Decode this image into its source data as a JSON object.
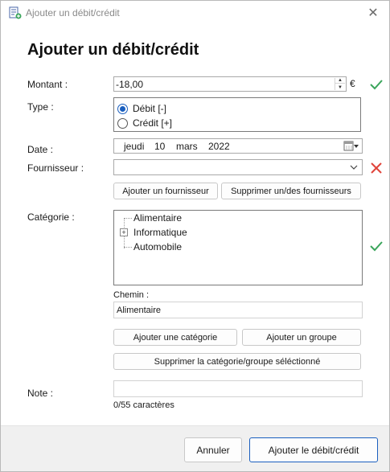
{
  "window": {
    "title": "Ajouter un débit/crédit",
    "close": "✕"
  },
  "form": {
    "heading": "Ajouter un débit/crédit",
    "amount": {
      "label": "Montant :",
      "value": "-18,00",
      "currency": "€",
      "valid": true
    },
    "type": {
      "label": "Type :",
      "options": [
        {
          "label": "Débit [-]",
          "selected": true
        },
        {
          "label": "Crédit [+]",
          "selected": false
        }
      ]
    },
    "date": {
      "label": "Date :",
      "weekday": "jeudi",
      "day": "10",
      "month": "mars",
      "year": "2022"
    },
    "supplier": {
      "label": "Fournisseur :",
      "value": "",
      "valid": false,
      "add_button": "Ajouter un fournisseur",
      "remove_button": "Supprimer un/des fournisseurs"
    },
    "category": {
      "label": "Catégorie :",
      "tree": [
        {
          "label": "Alimentaire",
          "expandable": false
        },
        {
          "label": "Informatique",
          "expandable": true
        },
        {
          "label": "Automobile",
          "expandable": false
        }
      ],
      "valid": true,
      "path_label": "Chemin :",
      "path_value": "Alimentaire",
      "add_category_button": "Ajouter une catégorie",
      "add_group_button": "Ajouter un groupe",
      "delete_button": "Supprimer la catégorie/groupe séléctionné"
    },
    "note": {
      "label": "Note :",
      "value": "",
      "char_count": "0/55 caractères"
    }
  },
  "footer": {
    "cancel": "Annuler",
    "submit": "Ajouter le débit/crédit"
  },
  "colors": {
    "accent": "#1a5fbf",
    "valid": "#3aa55b",
    "invalid": "#e0443a"
  }
}
